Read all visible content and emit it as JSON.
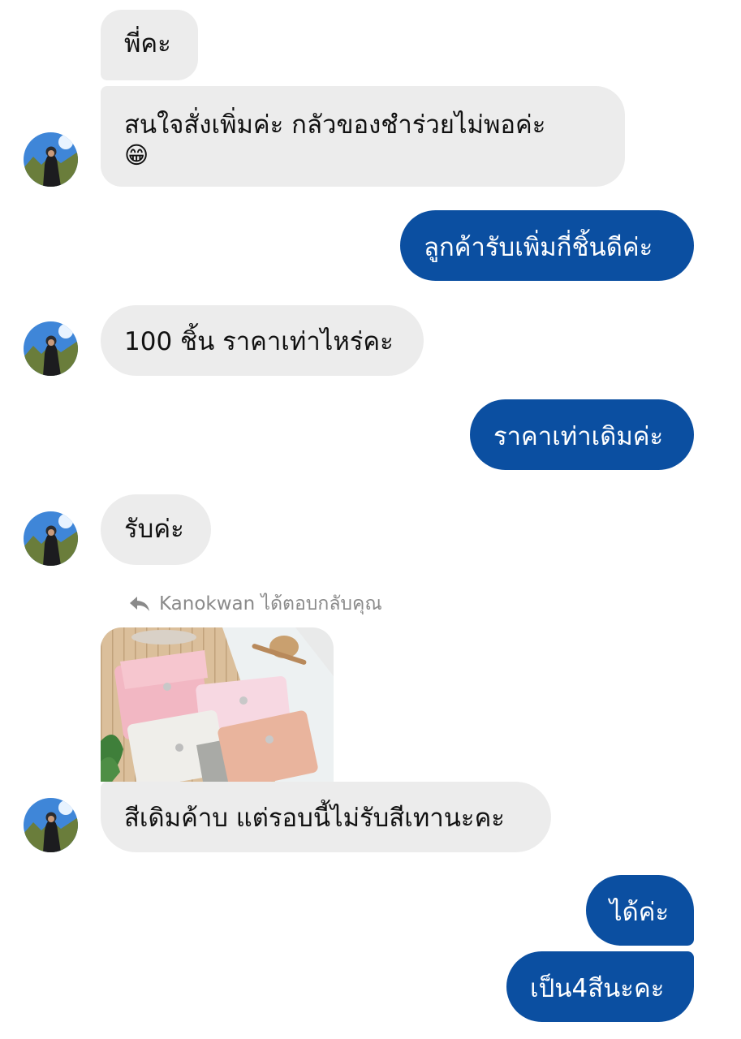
{
  "messages": [
    {
      "id": "m1",
      "side": "in",
      "text": "พี่คะ"
    },
    {
      "id": "m2",
      "side": "in",
      "text_line1": "สนใจสั่งเพิ่มค่ะ กลัวของชำร่วยไม่พอค่ะ",
      "emoji": "😁"
    },
    {
      "id": "m3",
      "side": "out",
      "text": "ลูกค้ารับเพิ่มกี่ชิ้นดีค่ะ"
    },
    {
      "id": "m4",
      "side": "in",
      "text": "100 ชิ้น ราคาเท่าไหร่คะ"
    },
    {
      "id": "m5",
      "side": "out",
      "text": "ราคาเท่าเดิมค่ะ"
    },
    {
      "id": "m6",
      "side": "in",
      "text": "รับค่ะ"
    },
    {
      "id": "m7",
      "side": "in",
      "text": "สีเดิมค้าบ แต่รอบนี้ไม่รับสีเทานะคะ"
    },
    {
      "id": "m8",
      "side": "out",
      "text": "ได้ค่ะ"
    },
    {
      "id": "m9",
      "side": "out",
      "text": "เป็น4สีนะคะ"
    }
  ],
  "reply_note": "Kanokwan ได้ตอบกลับคุณ",
  "icons": {
    "reply": "reply-arrow-icon",
    "avatar": "contact-avatar"
  },
  "colors": {
    "incoming_bubble": "#ececec",
    "outgoing_bubble": "#0b4fa1",
    "outgoing_text": "#ffffff",
    "meta_text": "#8a8a8a"
  }
}
